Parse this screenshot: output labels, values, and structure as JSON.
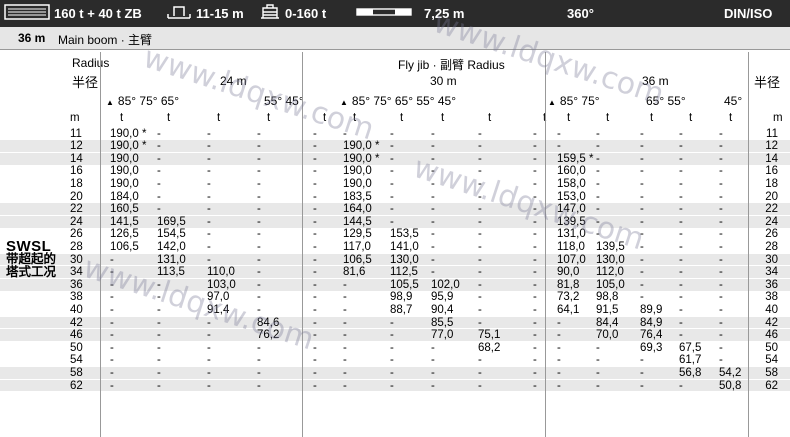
{
  "topbar": {
    "items": [
      {
        "icon": "counterweight-icon",
        "text": "160 t + 40 t ZB"
      },
      {
        "icon": "outrigger-base-icon",
        "text": "11-15 m"
      },
      {
        "icon": "ballast-icon",
        "text": "0-160 t"
      },
      {
        "icon": "outrigger-span-icon",
        "text": "7,25 m"
      },
      {
        "icon": "",
        "text": "360°"
      }
    ],
    "standard": "DIN/ISO"
  },
  "subbar": {
    "length": "36 m",
    "boom": "Main boom · 主臂"
  },
  "header": {
    "radius_en": "Radius",
    "radius_cn": "半径",
    "radius_cn_right": "半径",
    "fly_jib": "Fly jib · 副臂 Radius",
    "jib24": "24 m",
    "jib30": "30 m",
    "jib36": "36 m",
    "ang24a": "85° 75° 65°",
    "ang24b": "55° 45°",
    "ang30": "85° 75° 65° 55° 45°",
    "ang36a": "85° 75°",
    "ang36b": "65° 55°",
    "ang36c": "45°",
    "triangle": "▲"
  },
  "units": [
    "m",
    "t",
    "t",
    "t",
    "t",
    "t",
    "t",
    "t",
    "t",
    "t",
    "t",
    "t",
    "t",
    "t",
    "t",
    "t",
    "m"
  ],
  "side_label": {
    "line1": "SWSL",
    "line2": "带超起的",
    "line3": "塔式工况"
  },
  "rows": [
    [
      "11",
      "190,0 *",
      "-",
      "-",
      "-",
      "-",
      "-",
      "-",
      "-",
      "-",
      "-",
      "-",
      "-",
      "-",
      "-",
      "-",
      "11"
    ],
    [
      "12",
      "190,0 *",
      "-",
      "-",
      "-",
      "-",
      "190,0 *",
      "-",
      "-",
      "-",
      "-",
      "-",
      "-",
      "-",
      "-",
      "-",
      "12"
    ],
    [
      "14",
      "190,0",
      "-",
      "-",
      "-",
      "-",
      "190,0 *",
      "-",
      "-",
      "-",
      "-",
      "159,5 *",
      "-",
      "-",
      "-",
      "-",
      "14"
    ],
    [
      "16",
      "190,0",
      "-",
      "-",
      "-",
      "-",
      "190,0",
      "-",
      "-",
      "-",
      "-",
      "160,0",
      "-",
      "-",
      "-",
      "-",
      "16"
    ],
    [
      "18",
      "190,0",
      "-",
      "-",
      "-",
      "-",
      "190,0",
      "-",
      "-",
      "-",
      "-",
      "158,0",
      "-",
      "-",
      "-",
      "-",
      "18"
    ],
    [
      "20",
      "184,0",
      "-",
      "-",
      "-",
      "-",
      "183,5",
      "-",
      "-",
      "-",
      "-",
      "153,0",
      "-",
      "-",
      "-",
      "-",
      "20"
    ],
    [
      "22",
      "160,5",
      "-",
      "-",
      "-",
      "-",
      "164,0",
      "-",
      "-",
      "-",
      "-",
      "147,0",
      "-",
      "-",
      "-",
      "-",
      "22"
    ],
    [
      "24",
      "141,5",
      "169,5",
      "-",
      "-",
      "-",
      "144,5",
      "-",
      "-",
      "-",
      "-",
      "139,5",
      "-",
      "-",
      "-",
      "-",
      "24"
    ],
    [
      "26",
      "126,5",
      "154,5",
      "-",
      "-",
      "-",
      "129,5",
      "153,5",
      "-",
      "-",
      "-",
      "131,0",
      "-",
      "-",
      "-",
      "-",
      "26"
    ],
    [
      "28",
      "106,5",
      "142,0",
      "-",
      "-",
      "-",
      "117,0",
      "141,0",
      "-",
      "-",
      "-",
      "118,0",
      "139,5",
      "-",
      "-",
      "-",
      "28"
    ],
    [
      "30",
      "-",
      "131,0",
      "-",
      "-",
      "-",
      "106,5",
      "130,0",
      "-",
      "-",
      "-",
      "107,0",
      "130,0",
      "-",
      "-",
      "-",
      "30"
    ],
    [
      "34",
      "-",
      "113,5",
      "110,0",
      "-",
      "-",
      "81,6",
      "112,5",
      "-",
      "-",
      "-",
      "90,0",
      "112,0",
      "-",
      "-",
      "-",
      "34"
    ],
    [
      "36",
      "-",
      "-",
      "103,0",
      "-",
      "-",
      "-",
      "105,5",
      "102,0",
      "-",
      "-",
      "81,8",
      "105,0",
      "-",
      "-",
      "-",
      "36"
    ],
    [
      "38",
      "-",
      "-",
      "97,0",
      "-",
      "-",
      "-",
      "98,9",
      "95,9",
      "-",
      "-",
      "73,2",
      "98,8",
      "-",
      "-",
      "-",
      "38"
    ],
    [
      "40",
      "-",
      "-",
      "91,4",
      "-",
      "-",
      "-",
      "88,7",
      "90,4",
      "-",
      "-",
      "64,1",
      "91,5",
      "89,9",
      "-",
      "-",
      "40"
    ],
    [
      "42",
      "-",
      "-",
      "-",
      "84,6",
      "-",
      "-",
      "-",
      "85,5",
      "-",
      "-",
      "-",
      "84,4",
      "84,9",
      "-",
      "-",
      "42"
    ],
    [
      "46",
      "-",
      "-",
      "-",
      "76,2",
      "-",
      "-",
      "-",
      "77,0",
      "75,1",
      "-",
      "-",
      "70,0",
      "76,4",
      "-",
      "-",
      "46"
    ],
    [
      "50",
      "-",
      "-",
      "-",
      "-",
      "-",
      "-",
      "-",
      "-",
      "68,2",
      "-",
      "-",
      "-",
      "69,3",
      "67,5",
      "-",
      "50"
    ],
    [
      "54",
      "-",
      "-",
      "-",
      "-",
      "-",
      "-",
      "-",
      "-",
      "-",
      "-",
      "-",
      "-",
      "-",
      "61,7",
      "-",
      "54"
    ],
    [
      "58",
      "-",
      "-",
      "-",
      "-",
      "-",
      "-",
      "-",
      "-",
      "-",
      "-",
      "-",
      "-",
      "-",
      "56,8",
      "54,2",
      "58"
    ],
    [
      "62",
      "-",
      "-",
      "-",
      "-",
      "-",
      "-",
      "-",
      "-",
      "-",
      "-",
      "-",
      "-",
      "-",
      "-",
      "50,8",
      "62"
    ]
  ],
  "watermark": "www.ldqxw.com"
}
